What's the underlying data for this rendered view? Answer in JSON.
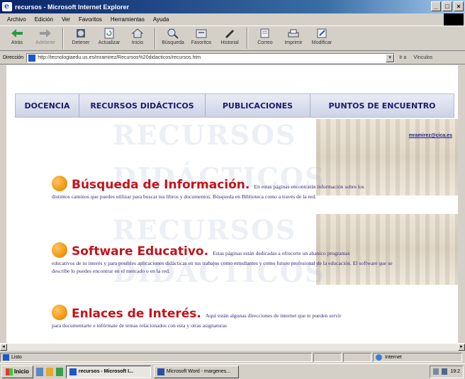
{
  "window": {
    "title": "recursos - Microsoft Internet Explorer",
    "buttons": [
      "_",
      "□",
      "×"
    ]
  },
  "menu": [
    "Archivo",
    "Edición",
    "Ver",
    "Favoritos",
    "Herramientas",
    "Ayuda"
  ],
  "toolbar": [
    {
      "label": "Atrás",
      "icon": "back-arrow-icon",
      "dim": false
    },
    {
      "label": "Adelante",
      "icon": "forward-arrow-icon",
      "dim": true
    },
    {
      "label": "Detener",
      "icon": "stop-icon",
      "dim": false
    },
    {
      "label": "Actualizar",
      "icon": "refresh-icon",
      "dim": false
    },
    {
      "label": "Inicio",
      "icon": "home-icon",
      "dim": false
    },
    {
      "label": "Búsqueda",
      "icon": "search-icon",
      "dim": false
    },
    {
      "label": "Favoritos",
      "icon": "favorites-icon",
      "dim": false
    },
    {
      "label": "Historial",
      "icon": "history-icon",
      "dim": false
    },
    {
      "label": "Correo",
      "icon": "mail-icon",
      "dim": false
    },
    {
      "label": "Imprimir",
      "icon": "print-icon",
      "dim": false
    },
    {
      "label": "Modificar",
      "icon": "edit-icon",
      "dim": false
    }
  ],
  "address": {
    "label": "Dirección",
    "url": "http://tecnologiaedu.us.es/mramirez/Recursos%20didacticos/recursos.htm",
    "go_label": "Ir a",
    "links_label": "Vínculos"
  },
  "page": {
    "nav": [
      "DOCENCIA",
      "RECURSOS DIDÁCTICOS",
      "PUBLICACIONES",
      "PUNTOS DE ENCUENTRO"
    ],
    "email": "mramirez@cica.es",
    "watermarks": [
      "RECURSOS",
      "DIDÁCTICOS",
      "RECURSOS",
      "DIDÁCTICOS"
    ],
    "sections": [
      {
        "title": "Búsqueda de Información.",
        "text_inline": "En estas páginas encontrarás información sobre los",
        "text_rest": "distintos caminos que puedes utilizar para buscar tus libros y documentos. Búsqueda en Biblioteca como a través de la red."
      },
      {
        "title": "Software Educativo.",
        "text_inline": "Estas páginas están dedicadas a ofrecerte un abanico programas",
        "text_rest": "educativos de tu interés y para posibles aplicaciones didácticas en tus trabajos como estudiantes y como futuro profesional de la educación. El software que se describe lo puedes encontrar en el mercado o en la red."
      },
      {
        "title": "Enlaces de Interés.",
        "text_inline": "Aquí están algunas direcciones de internet que te pueden servir",
        "text_rest": "para documentarte e infórmate de temas relacionados con esta y otras asignaturas"
      }
    ]
  },
  "status": {
    "left": "Listo",
    "zone": "Internet"
  },
  "taskbar": {
    "start": "Inicio",
    "tasks": [
      "recursos - Microsoft I...",
      "Microsoft Word - margenes..."
    ],
    "clock": "19:2"
  },
  "colors": {
    "title_blue": "#0a246a",
    "nav_text": "#1c1c6a",
    "section_title": "#c2141c",
    "body_text": "#3a2a7a",
    "bullet_orange": "#f29a10"
  }
}
